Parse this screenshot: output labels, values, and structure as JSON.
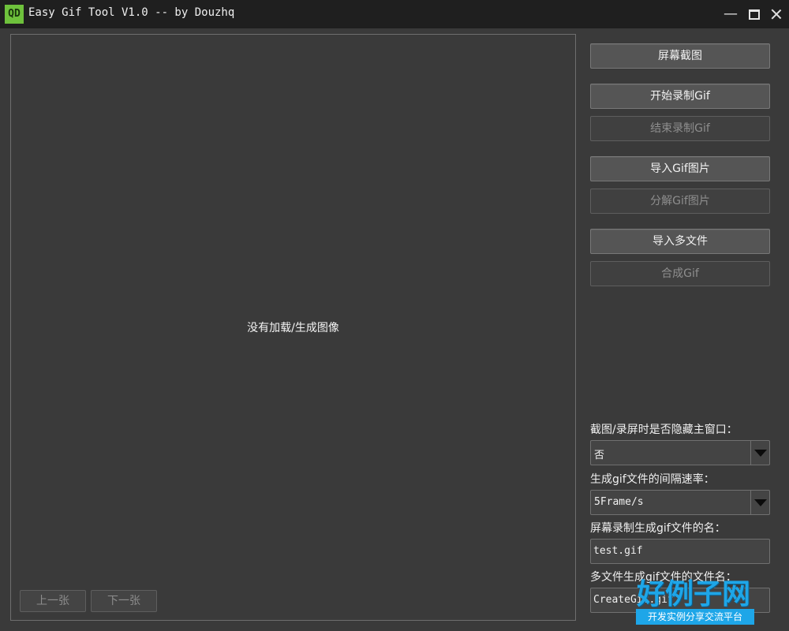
{
  "window": {
    "icon_text": "QD",
    "title": "Easy Gif Tool V1.0 -- by Douzhq",
    "minimize_glyph": "—"
  },
  "preview": {
    "placeholder": "没有加载/生成图像",
    "prev_label": "上一张",
    "next_label": "下一张"
  },
  "actions": {
    "screenshot": "屏幕截图",
    "start_record": "开始录制Gif",
    "stop_record": "结束录制Gif",
    "import_gif": "导入Gif图片",
    "split_gif": "分解Gif图片",
    "import_files": "导入多文件",
    "compose_gif": "合成Gif"
  },
  "settings": {
    "hide_label": "截图/录屏时是否隐藏主窗口：",
    "hide_value": "否",
    "rate_label": "生成gif文件的间隔速率：",
    "rate_value": "5Frame/s",
    "record_name_label": "屏幕录制生成gif文件的名：",
    "record_name_value": "test.gif",
    "multi_name_label": "多文件生成gif文件的文件名：",
    "multi_name_value": "CreateGif.gif"
  },
  "watermark": {
    "brand": "好例子网",
    "tagline": "开发实例分享交流平台"
  },
  "colors": {
    "background": "#3a3a3a",
    "titlebar": "#1f1f1f",
    "app_icon": "#6ec13c",
    "watermark": "#1ea6e8"
  }
}
